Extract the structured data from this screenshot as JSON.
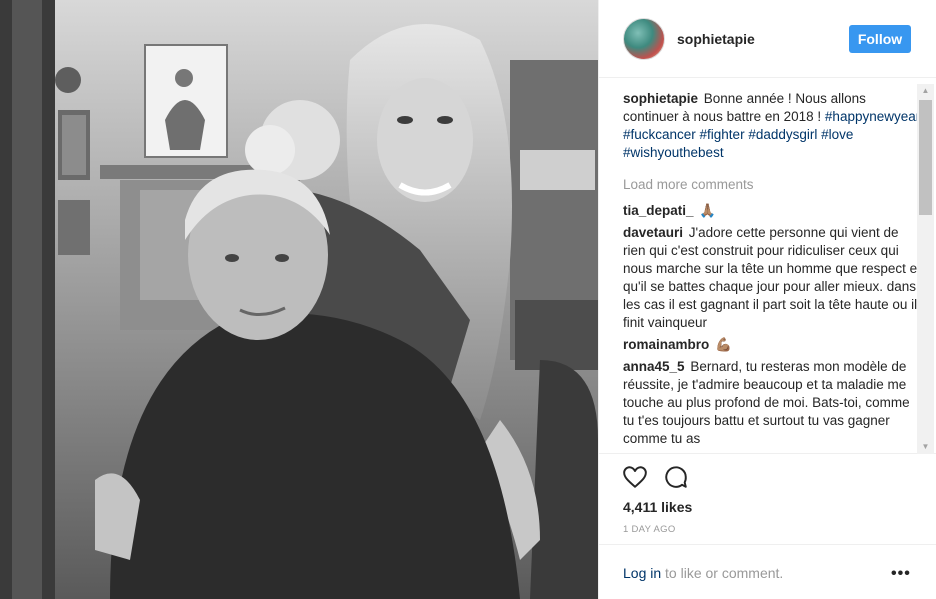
{
  "post": {
    "author": "sophietapie",
    "follow_label": "Follow",
    "caption": {
      "user": "sophietapie",
      "text": "Bonne année ! Nous allons continuer à nous battre en 2018 !",
      "hashtags": "#happynewyear #fuckcancer #fighter #daddysgirl #love #wishyouthebest"
    },
    "load_more": "Load more comments",
    "comments": [
      {
        "user": "tia_depati_",
        "text": "🙏🏽"
      },
      {
        "user": "davetauri",
        "text": "J'adore cette personne qui vient de rien qui c'est construit pour ridiculiser ceux qui nous marche sur la tête un homme que respect et qu'il se battes chaque jour pour aller mieux. dans les cas il est gagnant il part soit la tête haute ou il finit vainqueur"
      },
      {
        "user": "romainambro",
        "text": "💪🏽"
      },
      {
        "user": "anna45_5",
        "text": "Bernard, tu resteras mon modèle de réussite, je t'admire beaucoup et ta maladie me touche au plus profond de moi. Bats-toi, comme tu t'es toujours battu et surtout tu vas gagner comme tu as"
      }
    ],
    "likes": "4,411 likes",
    "time": "1 DAY AGO",
    "login_link": "Log in",
    "login_rest": " to like or comment.",
    "more_icon": "•••",
    "icons": {
      "like": "heart-icon",
      "comment": "speech-bubble-icon",
      "more": "more-options-icon"
    },
    "colors": {
      "accent": "#3897f0",
      "hashtag": "#003569",
      "muted": "#999999"
    }
  }
}
